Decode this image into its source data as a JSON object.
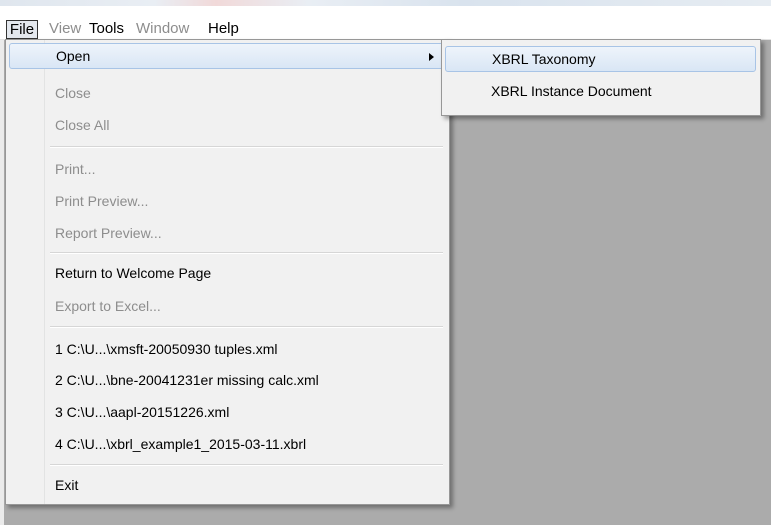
{
  "menubar": {
    "file": "File",
    "view": "View",
    "tools": "Tools",
    "window": "Window",
    "help": "Help"
  },
  "file_menu": {
    "open": "Open",
    "close": "Close",
    "close_all": "Close All",
    "print": "Print...",
    "print_preview": "Print Preview...",
    "report_preview": "Report Preview...",
    "return_welcome": "Return to Welcome Page",
    "export_excel": "Export to Excel...",
    "recent": [
      "1 C:\\U...\\xmsft-20050930 tuples.xml",
      "2 C:\\U...\\bne-20041231er missing calc.xml",
      "3 C:\\U...\\aapl-20151226.xml",
      "4 C:\\U...\\xbrl_example1_2015-03-11.xbrl"
    ],
    "exit": "Exit"
  },
  "open_submenu": {
    "taxonomy": "XBRL Taxonomy",
    "instance": "XBRL Instance Document"
  },
  "colors": {
    "workspace": "#ababab",
    "menu_bg": "#f1f1f1",
    "highlight_border": "#a8c4e6",
    "disabled_text": "#8d8d8d"
  }
}
